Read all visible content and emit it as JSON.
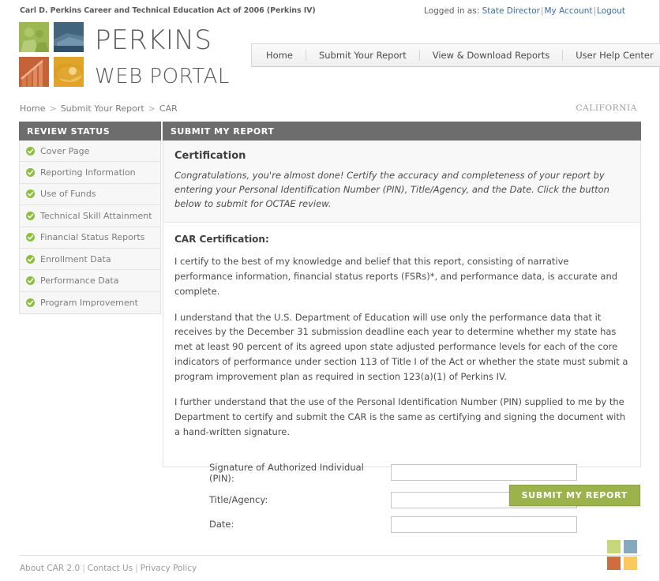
{
  "header": {
    "act_title": "Carl D. Perkins Career and Technical Education Act of 2006 (Perkins IV)",
    "logged_in_label": "Logged in as:",
    "user_role": "State Director",
    "my_account": "My Account",
    "logout": "Logout",
    "sep": "|",
    "wordmark_line1": "PERKINS",
    "wordmark_line2": "WEB PORTAL"
  },
  "nav": {
    "items": [
      {
        "label": "Home"
      },
      {
        "label": "Submit Your Report"
      },
      {
        "label": "View & Download Reports"
      },
      {
        "label": "User Help Center"
      }
    ]
  },
  "breadcrumb": {
    "items": [
      "Home",
      "Submit Your Report",
      "CAR"
    ],
    "separator": ">"
  },
  "state": {
    "label": "CALIFORNIA"
  },
  "panels": {
    "left_header": "REVIEW STATUS",
    "right_header": "SUBMIT MY REPORT"
  },
  "sidebar": {
    "items": [
      {
        "label": "Cover Page",
        "status": "complete"
      },
      {
        "label": "Reporting Information",
        "status": "complete"
      },
      {
        "label": "Use of Funds",
        "status": "complete"
      },
      {
        "label": "Technical Skill Attainment",
        "status": "complete"
      },
      {
        "label": "Financial Status Reports",
        "status": "complete"
      },
      {
        "label": "Enrollment Data",
        "status": "complete"
      },
      {
        "label": "Performance Data",
        "status": "complete"
      },
      {
        "label": "Program Improvement",
        "status": "complete"
      }
    ]
  },
  "certification": {
    "intro_heading": "Certification",
    "intro_text": "Congratulations, you're almost done! Certify the accuracy and completeness of your report by entering your Personal Identification Number (PIN), Title/Agency, and the Date. Click the button below to submit for OCTAE review.",
    "section_heading": "CAR Certification:",
    "paragraph_1": "I certify to the best of my knowledge and belief that this report, consisting of narrative performance information, financial status reports (FSRs)*, and performance data, is accurate and complete.",
    "paragraph_2": "I understand that the U.S. Department of Education will use only the performance data that it receives by the December 31 submission deadline each year to determine whether my state has met at least 90 percent of its agreed upon state adjusted performance levels for each of the core indicators of performance under section 113 of Title I of the Act or whether the state must submit a program improvement plan as required in section 123(a)(1) of Perkins IV.",
    "paragraph_3": "I further understand that the use of the Personal Identification Number (PIN) supplied to me by the Department to certify and submit the CAR is the same as certifying and signing the document with a hand-written signature."
  },
  "form": {
    "fields": [
      {
        "label": "Signature of Authorized Individual (PIN):",
        "value": "",
        "placeholder": ""
      },
      {
        "label": "Title/Agency:",
        "value": "",
        "placeholder": ""
      },
      {
        "label": "Date:",
        "value": "",
        "placeholder": ""
      }
    ]
  },
  "actions": {
    "submit_label": "SUBMIT MY REPORT"
  },
  "footer": {
    "links": [
      "About CAR 2.0",
      "Contact Us",
      "Privacy Policy"
    ],
    "separator": "|",
    "squares": [
      "#c4d779",
      "#86a9bd",
      "#ce6e3f",
      "#fcc95e"
    ]
  },
  "colors": {
    "header_bar": "#6d6d6d",
    "accent_green": "#9cb24b",
    "link_blue": "#3c6ea5",
    "check_green": "#8dbf3f"
  }
}
